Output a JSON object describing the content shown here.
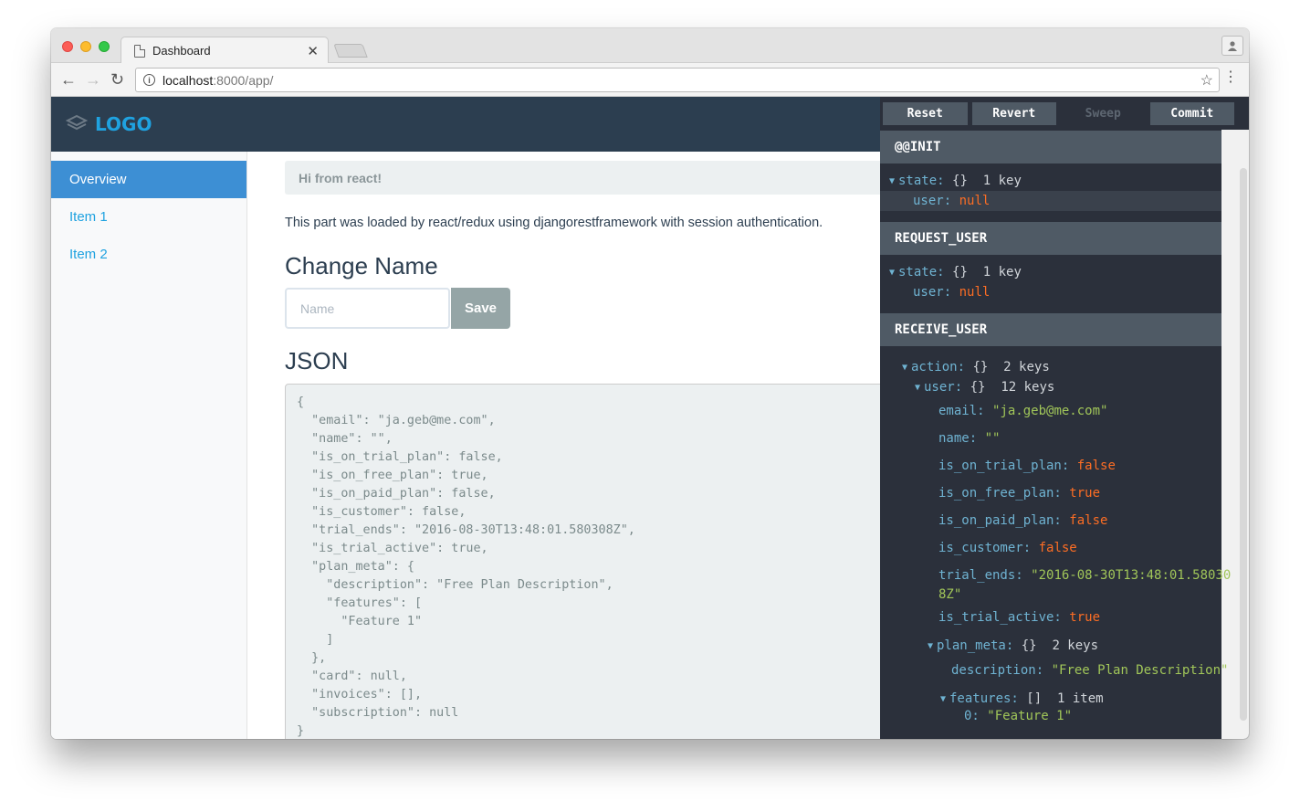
{
  "browser": {
    "tab_title": "Dashboard",
    "url_host": "localhost",
    "url_rest": ":8000/app/"
  },
  "app": {
    "logo": "LOGO",
    "sidebar": [
      {
        "label": "Overview",
        "active": true
      },
      {
        "label": "Item 1",
        "active": false
      },
      {
        "label": "Item 2",
        "active": false
      }
    ],
    "alert": "Hi from react!",
    "description": "This part was loaded by react/redux using djangorestframework with session authentication.",
    "change_name_heading": "Change Name",
    "name_placeholder": "Name",
    "save_label": "Save",
    "json_heading": "JSON",
    "json_text": "{\n  \"email\": \"ja.geb@me.com\",\n  \"name\": \"\",\n  \"is_on_trial_plan\": false,\n  \"is_on_free_plan\": true,\n  \"is_on_paid_plan\": false,\n  \"is_customer\": false,\n  \"trial_ends\": \"2016-08-30T13:48:01.580308Z\",\n  \"is_trial_active\": true,\n  \"plan_meta\": {\n    \"description\": \"Free Plan Description\",\n    \"features\": [\n      \"Feature 1\"\n    ]\n  },\n  \"card\": null,\n  \"invoices\": [],\n  \"subscription\": null\n}"
  },
  "devtools": {
    "buttons": {
      "reset": "Reset",
      "revert": "Revert",
      "sweep": "Sweep",
      "commit": "Commit"
    },
    "actions": [
      {
        "name": "@@INIT",
        "state_key": "state:",
        "braces": "{}",
        "count": "1 key",
        "user_key": "user:",
        "user_val": "null"
      },
      {
        "name": "REQUEST_USER",
        "state_key": "state:",
        "braces": "{}",
        "count": "1 key",
        "user_key": "user:",
        "user_val": "null"
      },
      {
        "name": "RECEIVE_USER",
        "action_key": "action:",
        "action_braces": "{}",
        "action_count": "2 keys",
        "user_key": "user:",
        "user_braces": "{}",
        "user_count": "12 keys"
      }
    ],
    "user_fields": {
      "email_key": "email:",
      "email_val": "\"ja.geb@me.com\"",
      "name_key": "name:",
      "name_val": "\"\"",
      "trial_key": "is_on_trial_plan:",
      "trial_val": "false",
      "free_key": "is_on_free_plan:",
      "free_val": "true",
      "paid_key": "is_on_paid_plan:",
      "paid_val": "false",
      "customer_key": "is_customer:",
      "customer_val": "false",
      "ends_key": "trial_ends:",
      "ends_val1": "\"2016-08-30T13:48:01.58030",
      "ends_val2": "8Z\"",
      "active_key": "is_trial_active:",
      "active_val": "true",
      "meta_key": "plan_meta:",
      "meta_braces": "{}",
      "meta_count": "2 keys",
      "desc_key": "description:",
      "desc_val": "\"Free Plan Description\"",
      "features_key": "features:",
      "features_braces": "[]",
      "features_count": "1 item",
      "f0_key": "0:",
      "f0_val": "\"Feature 1\""
    },
    "colors": {
      "key": "#6fb3d2",
      "string": "#a1c659",
      "literal": "#fc6d24",
      "bg": "#2b303b"
    }
  }
}
